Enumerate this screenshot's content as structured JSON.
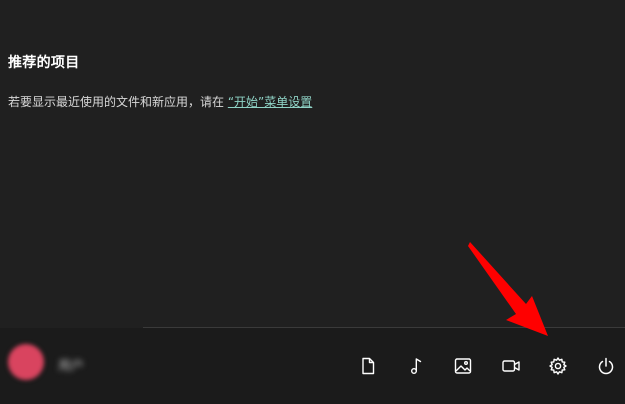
{
  "recommended": {
    "heading": "推荐的项目",
    "description_prefix": "若要显示最近使用的文件和新应用，请在",
    "settings_link": "“开始”菜单设置"
  },
  "footer": {
    "user_name": "用户",
    "icons": [
      "document-icon",
      "music-icon",
      "pictures-icon",
      "video-icon",
      "settings-gear-icon",
      "power-icon"
    ]
  },
  "colors": {
    "background": "#202020",
    "link": "#8fd3c6",
    "annotation_arrow": "#ff0000",
    "avatar": "#d9445f"
  }
}
